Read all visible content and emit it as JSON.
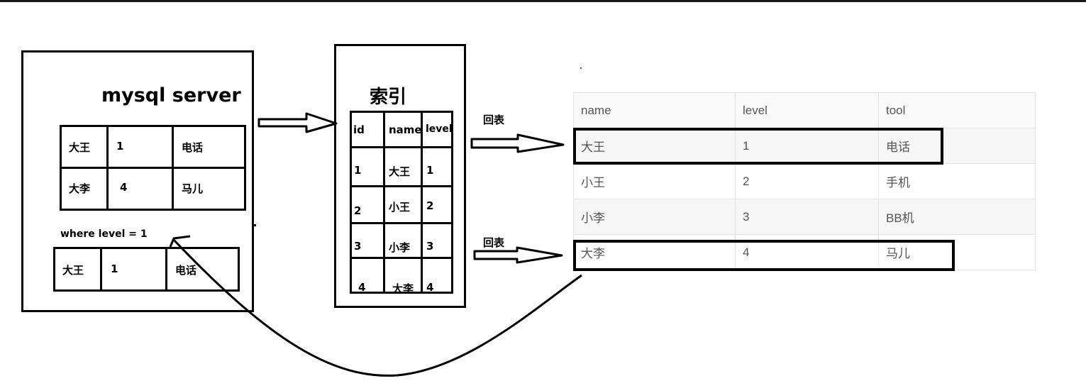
{
  "server": {
    "title": "mysql server",
    "rows": [
      [
        "大王",
        "1",
        "电话"
      ],
      [
        "大李",
        "4",
        "马儿"
      ]
    ],
    "where_clause": "where level = 1",
    "result_row": [
      "大王",
      "1",
      "电话"
    ]
  },
  "index": {
    "title": "索引",
    "headers": [
      "id",
      "name",
      "level"
    ],
    "rows": [
      [
        "1",
        "大王",
        "1"
      ],
      [
        "2",
        "小王",
        "2"
      ],
      [
        "3",
        "小李",
        "3"
      ],
      [
        "4",
        "大李",
        "4"
      ]
    ]
  },
  "lookback_label_1": "回表",
  "lookback_label_2": "回表",
  "table": {
    "headers": [
      "name",
      "level",
      "tool"
    ],
    "rows": [
      [
        "大王",
        "1",
        "电话"
      ],
      [
        "小王",
        "2",
        "手机"
      ],
      [
        "小李",
        "3",
        "BB机"
      ],
      [
        "大李",
        "4",
        "马儿"
      ]
    ]
  }
}
